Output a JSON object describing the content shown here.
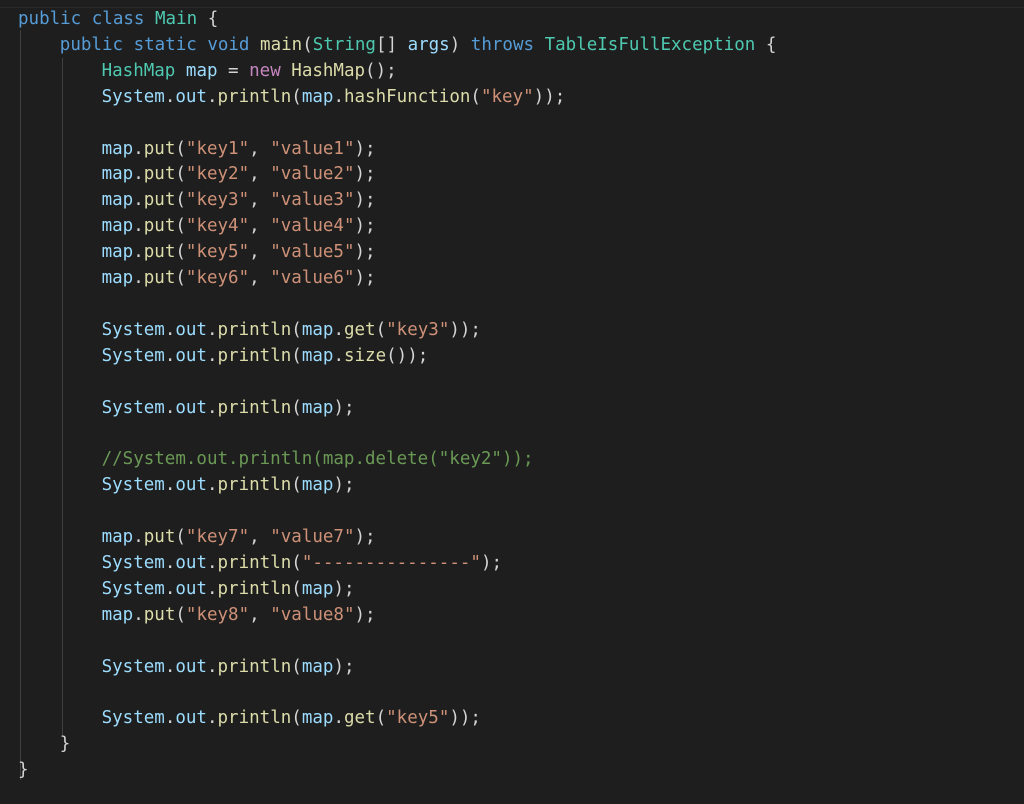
{
  "editor": {
    "language": "java",
    "theme": {
      "background": "#1e1e1e",
      "keyword": "#569cd6",
      "type": "#4ec9b0",
      "function": "#dcdcaa",
      "variable": "#9cdcfe",
      "string": "#ce9178",
      "comment": "#6a9955",
      "new_keyword": "#c586c0",
      "plain": "#d4d4d4"
    },
    "lines": [
      {
        "indent": 0,
        "tokens": [
          {
            "t": "kw",
            "v": "public"
          },
          {
            "t": "p",
            "v": " "
          },
          {
            "t": "kw",
            "v": "class"
          },
          {
            "t": "p",
            "v": " "
          },
          {
            "t": "ty",
            "v": "Main"
          },
          {
            "t": "p",
            "v": " {"
          }
        ]
      },
      {
        "indent": 1,
        "tokens": [
          {
            "t": "kw",
            "v": "public"
          },
          {
            "t": "p",
            "v": " "
          },
          {
            "t": "kw",
            "v": "static"
          },
          {
            "t": "p",
            "v": " "
          },
          {
            "t": "kw",
            "v": "void"
          },
          {
            "t": "p",
            "v": " "
          },
          {
            "t": "fn",
            "v": "main"
          },
          {
            "t": "p",
            "v": "("
          },
          {
            "t": "ty",
            "v": "String"
          },
          {
            "t": "p",
            "v": "[] "
          },
          {
            "t": "va",
            "v": "args"
          },
          {
            "t": "p",
            "v": ") "
          },
          {
            "t": "kw",
            "v": "throws"
          },
          {
            "t": "p",
            "v": " "
          },
          {
            "t": "ty",
            "v": "TableIsFullException"
          },
          {
            "t": "p",
            "v": " {"
          }
        ]
      },
      {
        "indent": 2,
        "tokens": [
          {
            "t": "ty",
            "v": "HashMap"
          },
          {
            "t": "p",
            "v": " "
          },
          {
            "t": "va",
            "v": "map"
          },
          {
            "t": "p",
            "v": " = "
          },
          {
            "t": "nw",
            "v": "new"
          },
          {
            "t": "p",
            "v": " "
          },
          {
            "t": "fn",
            "v": "HashMap"
          },
          {
            "t": "p",
            "v": "();"
          }
        ]
      },
      {
        "indent": 2,
        "tokens": [
          {
            "t": "va",
            "v": "System"
          },
          {
            "t": "p",
            "v": "."
          },
          {
            "t": "va",
            "v": "out"
          },
          {
            "t": "p",
            "v": "."
          },
          {
            "t": "fn",
            "v": "println"
          },
          {
            "t": "p",
            "v": "("
          },
          {
            "t": "va",
            "v": "map"
          },
          {
            "t": "p",
            "v": "."
          },
          {
            "t": "fn",
            "v": "hashFunction"
          },
          {
            "t": "p",
            "v": "("
          },
          {
            "t": "st",
            "v": "\"key\""
          },
          {
            "t": "p",
            "v": "));"
          }
        ]
      },
      {
        "indent": 2,
        "tokens": []
      },
      {
        "indent": 2,
        "tokens": [
          {
            "t": "va",
            "v": "map"
          },
          {
            "t": "p",
            "v": "."
          },
          {
            "t": "fn",
            "v": "put"
          },
          {
            "t": "p",
            "v": "("
          },
          {
            "t": "st",
            "v": "\"key1\""
          },
          {
            "t": "p",
            "v": ", "
          },
          {
            "t": "st",
            "v": "\"value1\""
          },
          {
            "t": "p",
            "v": ");"
          }
        ]
      },
      {
        "indent": 2,
        "tokens": [
          {
            "t": "va",
            "v": "map"
          },
          {
            "t": "p",
            "v": "."
          },
          {
            "t": "fn",
            "v": "put"
          },
          {
            "t": "p",
            "v": "("
          },
          {
            "t": "st",
            "v": "\"key2\""
          },
          {
            "t": "p",
            "v": ", "
          },
          {
            "t": "st",
            "v": "\"value2\""
          },
          {
            "t": "p",
            "v": ");"
          }
        ]
      },
      {
        "indent": 2,
        "tokens": [
          {
            "t": "va",
            "v": "map"
          },
          {
            "t": "p",
            "v": "."
          },
          {
            "t": "fn",
            "v": "put"
          },
          {
            "t": "p",
            "v": "("
          },
          {
            "t": "st",
            "v": "\"key3\""
          },
          {
            "t": "p",
            "v": ", "
          },
          {
            "t": "st",
            "v": "\"value3\""
          },
          {
            "t": "p",
            "v": ");"
          }
        ]
      },
      {
        "indent": 2,
        "tokens": [
          {
            "t": "va",
            "v": "map"
          },
          {
            "t": "p",
            "v": "."
          },
          {
            "t": "fn",
            "v": "put"
          },
          {
            "t": "p",
            "v": "("
          },
          {
            "t": "st",
            "v": "\"key4\""
          },
          {
            "t": "p",
            "v": ", "
          },
          {
            "t": "st",
            "v": "\"value4\""
          },
          {
            "t": "p",
            "v": ");"
          }
        ]
      },
      {
        "indent": 2,
        "tokens": [
          {
            "t": "va",
            "v": "map"
          },
          {
            "t": "p",
            "v": "."
          },
          {
            "t": "fn",
            "v": "put"
          },
          {
            "t": "p",
            "v": "("
          },
          {
            "t": "st",
            "v": "\"key5\""
          },
          {
            "t": "p",
            "v": ", "
          },
          {
            "t": "st",
            "v": "\"value5\""
          },
          {
            "t": "p",
            "v": ");"
          }
        ]
      },
      {
        "indent": 2,
        "tokens": [
          {
            "t": "va",
            "v": "map"
          },
          {
            "t": "p",
            "v": "."
          },
          {
            "t": "fn",
            "v": "put"
          },
          {
            "t": "p",
            "v": "("
          },
          {
            "t": "st",
            "v": "\"key6\""
          },
          {
            "t": "p",
            "v": ", "
          },
          {
            "t": "st",
            "v": "\"value6\""
          },
          {
            "t": "p",
            "v": ");"
          }
        ]
      },
      {
        "indent": 2,
        "tokens": []
      },
      {
        "indent": 2,
        "tokens": [
          {
            "t": "va",
            "v": "System"
          },
          {
            "t": "p",
            "v": "."
          },
          {
            "t": "va",
            "v": "out"
          },
          {
            "t": "p",
            "v": "."
          },
          {
            "t": "fn",
            "v": "println"
          },
          {
            "t": "p",
            "v": "("
          },
          {
            "t": "va",
            "v": "map"
          },
          {
            "t": "p",
            "v": "."
          },
          {
            "t": "fn",
            "v": "get"
          },
          {
            "t": "p",
            "v": "("
          },
          {
            "t": "st",
            "v": "\"key3\""
          },
          {
            "t": "p",
            "v": "));"
          }
        ]
      },
      {
        "indent": 2,
        "tokens": [
          {
            "t": "va",
            "v": "System"
          },
          {
            "t": "p",
            "v": "."
          },
          {
            "t": "va",
            "v": "out"
          },
          {
            "t": "p",
            "v": "."
          },
          {
            "t": "fn",
            "v": "println"
          },
          {
            "t": "p",
            "v": "("
          },
          {
            "t": "va",
            "v": "map"
          },
          {
            "t": "p",
            "v": "."
          },
          {
            "t": "fn",
            "v": "size"
          },
          {
            "t": "p",
            "v": "());"
          }
        ]
      },
      {
        "indent": 2,
        "tokens": []
      },
      {
        "indent": 2,
        "tokens": [
          {
            "t": "va",
            "v": "System"
          },
          {
            "t": "p",
            "v": "."
          },
          {
            "t": "va",
            "v": "out"
          },
          {
            "t": "p",
            "v": "."
          },
          {
            "t": "fn",
            "v": "println"
          },
          {
            "t": "p",
            "v": "("
          },
          {
            "t": "va",
            "v": "map"
          },
          {
            "t": "p",
            "v": ");"
          }
        ]
      },
      {
        "indent": 2,
        "tokens": []
      },
      {
        "indent": 2,
        "tokens": [
          {
            "t": "cm",
            "v": "//System.out.println(map.delete(\"key2\"));"
          }
        ]
      },
      {
        "indent": 2,
        "tokens": [
          {
            "t": "va",
            "v": "System"
          },
          {
            "t": "p",
            "v": "."
          },
          {
            "t": "va",
            "v": "out"
          },
          {
            "t": "p",
            "v": "."
          },
          {
            "t": "fn",
            "v": "println"
          },
          {
            "t": "p",
            "v": "("
          },
          {
            "t": "va",
            "v": "map"
          },
          {
            "t": "p",
            "v": ");"
          }
        ]
      },
      {
        "indent": 2,
        "tokens": []
      },
      {
        "indent": 2,
        "tokens": [
          {
            "t": "va",
            "v": "map"
          },
          {
            "t": "p",
            "v": "."
          },
          {
            "t": "fn",
            "v": "put"
          },
          {
            "t": "p",
            "v": "("
          },
          {
            "t": "st",
            "v": "\"key7\""
          },
          {
            "t": "p",
            "v": ", "
          },
          {
            "t": "st",
            "v": "\"value7\""
          },
          {
            "t": "p",
            "v": ");"
          }
        ]
      },
      {
        "indent": 2,
        "tokens": [
          {
            "t": "va",
            "v": "System"
          },
          {
            "t": "p",
            "v": "."
          },
          {
            "t": "va",
            "v": "out"
          },
          {
            "t": "p",
            "v": "."
          },
          {
            "t": "fn",
            "v": "println"
          },
          {
            "t": "p",
            "v": "("
          },
          {
            "t": "st",
            "v": "\"---------------\""
          },
          {
            "t": "p",
            "v": ");"
          }
        ]
      },
      {
        "indent": 2,
        "tokens": [
          {
            "t": "va",
            "v": "System"
          },
          {
            "t": "p",
            "v": "."
          },
          {
            "t": "va",
            "v": "out"
          },
          {
            "t": "p",
            "v": "."
          },
          {
            "t": "fn",
            "v": "println"
          },
          {
            "t": "p",
            "v": "("
          },
          {
            "t": "va",
            "v": "map"
          },
          {
            "t": "p",
            "v": ");"
          }
        ]
      },
      {
        "indent": 2,
        "tokens": [
          {
            "t": "va",
            "v": "map"
          },
          {
            "t": "p",
            "v": "."
          },
          {
            "t": "fn",
            "v": "put"
          },
          {
            "t": "p",
            "v": "("
          },
          {
            "t": "st",
            "v": "\"key8\""
          },
          {
            "t": "p",
            "v": ", "
          },
          {
            "t": "st",
            "v": "\"value8\""
          },
          {
            "t": "p",
            "v": ");"
          }
        ]
      },
      {
        "indent": 2,
        "tokens": []
      },
      {
        "indent": 2,
        "tokens": [
          {
            "t": "va",
            "v": "System"
          },
          {
            "t": "p",
            "v": "."
          },
          {
            "t": "va",
            "v": "out"
          },
          {
            "t": "p",
            "v": "."
          },
          {
            "t": "fn",
            "v": "println"
          },
          {
            "t": "p",
            "v": "("
          },
          {
            "t": "va",
            "v": "map"
          },
          {
            "t": "p",
            "v": ");"
          }
        ]
      },
      {
        "indent": 2,
        "tokens": []
      },
      {
        "indent": 2,
        "tokens": [
          {
            "t": "va",
            "v": "System"
          },
          {
            "t": "p",
            "v": "."
          },
          {
            "t": "va",
            "v": "out"
          },
          {
            "t": "p",
            "v": "."
          },
          {
            "t": "fn",
            "v": "println"
          },
          {
            "t": "p",
            "v": "("
          },
          {
            "t": "va",
            "v": "map"
          },
          {
            "t": "p",
            "v": "."
          },
          {
            "t": "fn",
            "v": "get"
          },
          {
            "t": "p",
            "v": "("
          },
          {
            "t": "st",
            "v": "\"key5\""
          },
          {
            "t": "p",
            "v": "));"
          }
        ]
      },
      {
        "indent": 1,
        "tokens": [
          {
            "t": "p",
            "v": "}"
          }
        ]
      },
      {
        "indent": 0,
        "tokens": [
          {
            "t": "p",
            "v": "}"
          }
        ]
      }
    ]
  }
}
